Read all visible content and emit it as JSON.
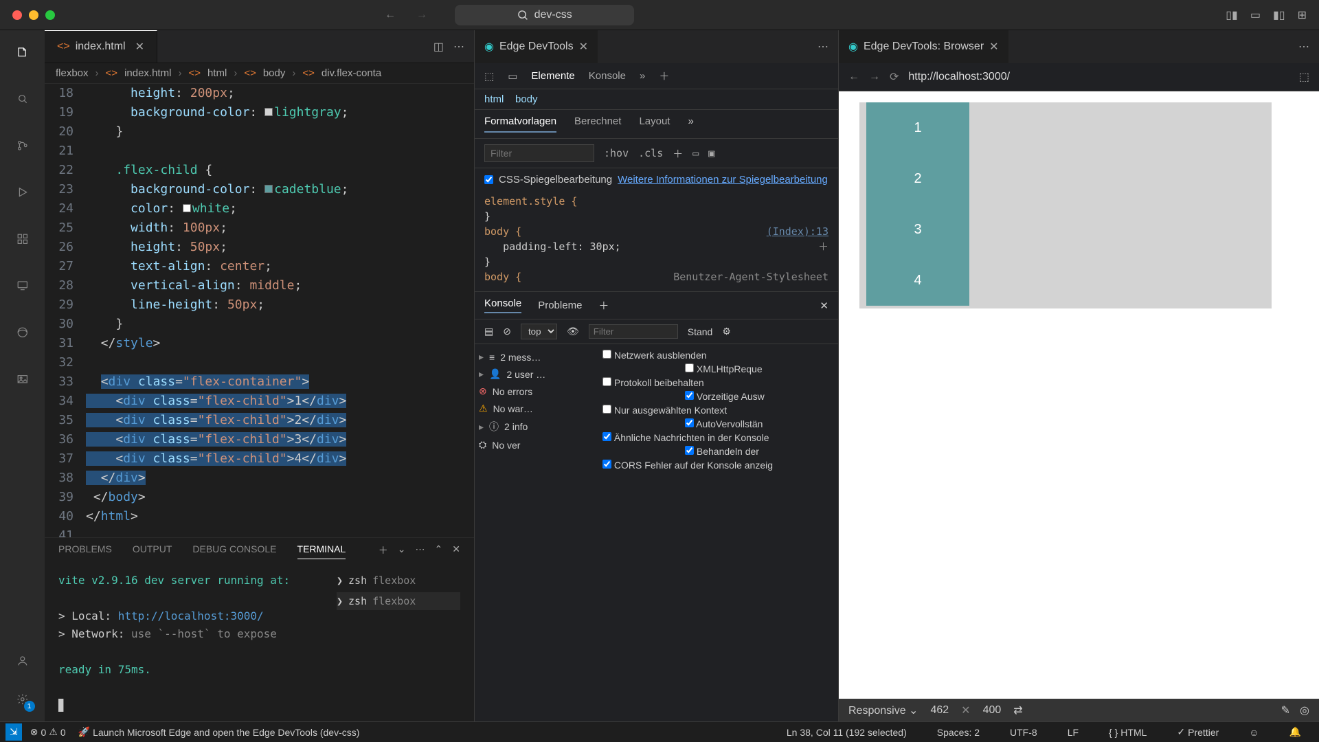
{
  "title_bar": {
    "project": "dev-css"
  },
  "editor": {
    "tab_file": "index.html",
    "breadcrumbs": [
      "flexbox",
      "index.html",
      "html",
      "body",
      "div.flex-conta"
    ],
    "lines": {
      "18": "      height: 200px;",
      "19": "      background-color: lightgray;",
      "20": "    }",
      "21": "",
      "22": "    .flex-child {",
      "23": "      background-color: cadetblue;",
      "24": "      color: white;",
      "25": "      width: 100px;",
      "26": "      height: 50px;",
      "27": "      text-align: center;",
      "28": "      vertical-align: middle;",
      "29": "      line-height: 50px;",
      "30": "    }",
      "31": "  </style>",
      "32": "",
      "33": "  <div class=\"flex-container\">",
      "34": "    <div class=\"flex-child\">1</div>",
      "35": "    <div class=\"flex-child\">2</div>",
      "36": "    <div class=\"flex-child\">3</div>",
      "37": "    <div class=\"flex-child\">4</div>",
      "38": "  </div>",
      "39": " </body>",
      "40": "</html>"
    }
  },
  "devtools": {
    "tab_title": "Edge DevTools",
    "toolbar": {
      "elements": "Elemente",
      "console": "Konsole"
    },
    "path_html": "html",
    "path_body": "body",
    "styles_tabs": {
      "format": "Formatvorlagen",
      "computed": "Berechnet",
      "layout": "Layout"
    },
    "filter_ph": "Filter",
    "hov": ":hov",
    "cls": ".cls",
    "mirror_label": "CSS-Spiegelbearbeitung",
    "mirror_link": "Weitere Informationen zur Spiegelbearbeitung",
    "rule_element": "element.style {",
    "rule_body_open": "body {",
    "rule_body_link": "(Index):13",
    "rule_body_prop": "padding-left: 30px;",
    "rule_body_ua": "body {",
    "rule_ua_label": "Benutzer-Agent-Stylesheet",
    "console_tabs": {
      "konsole": "Konsole",
      "probleme": "Probleme"
    },
    "console_ctx": "top",
    "console_filter_ph": "Filter",
    "console_level": "Stand",
    "msgs": {
      "m2": "2 mess…",
      "u2": "2 user …",
      "noerr": "No errors",
      "nowarn": "No war…",
      "i2": "2 info",
      "nover": "No ver"
    },
    "checks": {
      "net": "Netzwerk ausblenden",
      "xhr": "XMLHttpReque",
      "proto": "Protokoll beibehalten",
      "vorz": "Vorzeitige Ausw",
      "nur": "Nur ausgewählten Kontext",
      "auto": "AutoVervollstän",
      "ahn": "Ähnliche Nachrichten in der Konsole",
      "behand": "Behandeln der",
      "cors": "CORS Fehler auf der Konsole anzeig"
    }
  },
  "browser": {
    "tab_title": "Edge DevTools: Browser",
    "url": "http://localhost:3000/",
    "items": [
      "1",
      "2",
      "3",
      "4"
    ],
    "responsive": "Responsive",
    "w": "462",
    "h": "400"
  },
  "panel": {
    "problems": "PROBLEMS",
    "output": "OUTPUT",
    "debug": "DEBUG CONSOLE",
    "terminal": "TERMINAL",
    "line1": "vite v2.9.16 dev server running at:",
    "local": "> Local: ",
    "local_url": "http://localhost:3000/",
    "network": "> Network: ",
    "network_hint": "use `--host` to expose",
    "ready": "ready in 75ms.",
    "shell1": "zsh",
    "label1": "flexbox",
    "shell2": "zsh",
    "label2": "flexbox"
  },
  "status": {
    "remote": "⌘",
    "err": "0",
    "warn": "0",
    "launch": "Launch Microsoft Edge and open the Edge DevTools (dev-css)",
    "pos": "Ln 38, Col 11 (192 selected)",
    "spaces": "Spaces: 2",
    "enc": "UTF-8",
    "eol": "LF",
    "lang": "HTML",
    "prettier": "Prettier"
  }
}
